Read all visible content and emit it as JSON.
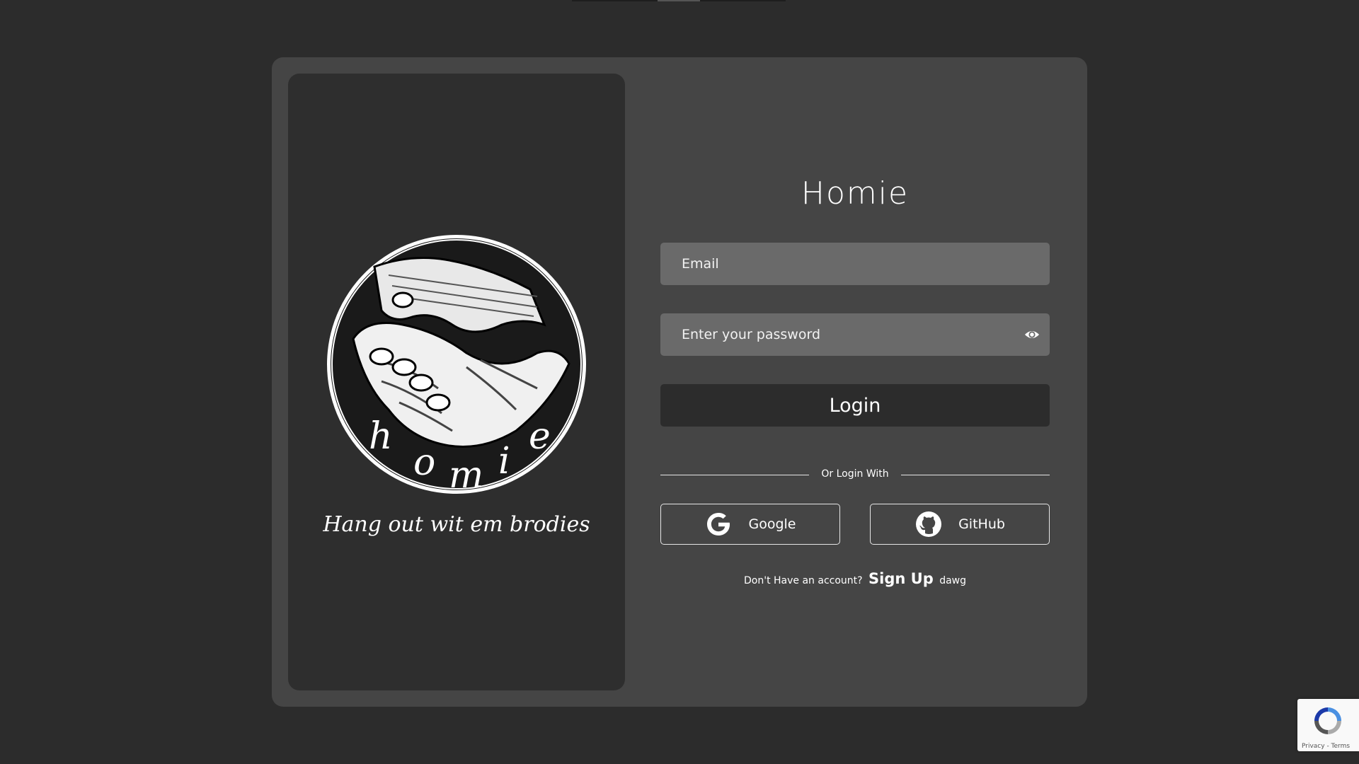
{
  "left_panel": {
    "tagline": "Hang out wit em brodies",
    "logo_icon": "handshake-icon",
    "logo_text": "homie"
  },
  "form": {
    "title": "Homie",
    "email_placeholder": "Email",
    "password_placeholder": "Enter your password",
    "login_label": "Login",
    "divider_text": "Or Login With",
    "google_label": "Google",
    "github_label": "GitHub",
    "signup_prefix": "Don't Have an account?",
    "signup_link": "Sign Up",
    "signup_suffix": "dawg"
  },
  "recaptcha": {
    "terms": "Privacy - Terms"
  },
  "colors": {
    "background": "#2c2c2c",
    "card": "#454545",
    "left_panel": "#2e2e2e",
    "input": "#6a6a6a",
    "button": "#2c2c2c"
  }
}
